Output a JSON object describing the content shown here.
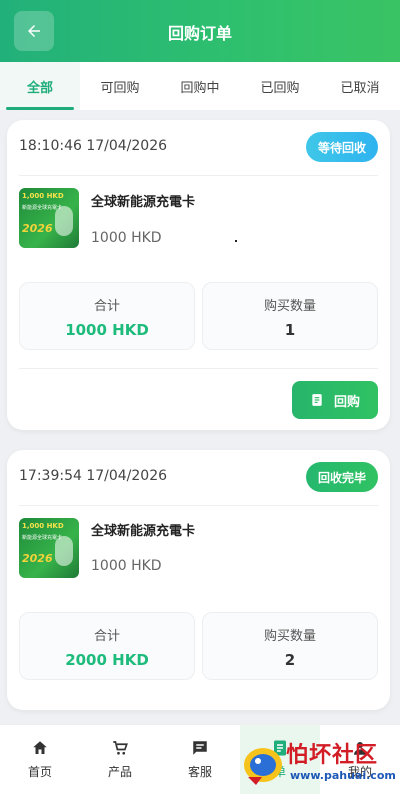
{
  "header": {
    "title": "回购订单"
  },
  "tabs": [
    {
      "label": "全部",
      "active": true
    },
    {
      "label": "可回购"
    },
    {
      "label": "回购中"
    },
    {
      "label": "已回购"
    },
    {
      "label": "已取消"
    }
  ],
  "orders": [
    {
      "time": "18:10:46 17/04/2026",
      "status": "等待回收",
      "product": {
        "name": "全球新能源充電卡",
        "price": "1000 HKD",
        "thumb": {
          "line1": "1,000 HKD",
          "line2": "新能源全球充電卡",
          "year": "2026"
        }
      },
      "total_label": "合计",
      "total_value": "1000 HKD",
      "qty_label": "购买数量",
      "qty_value": "1",
      "action_label": "回购"
    },
    {
      "time": "17:39:54 17/04/2026",
      "status": "回收完毕",
      "product": {
        "name": "全球新能源充電卡",
        "price": "1000 HKD",
        "thumb": {
          "line1": "1,000 HKD",
          "line2": "新能源全球充電卡",
          "year": "2026"
        }
      },
      "total_label": "合计",
      "total_value": "2000 HKD",
      "qty_label": "购买数量",
      "qty_value": "2"
    }
  ],
  "nav": [
    {
      "label": "首页",
      "icon": "home-icon"
    },
    {
      "label": "产品",
      "icon": "cart-icon"
    },
    {
      "label": "客服",
      "icon": "chat-icon"
    },
    {
      "label": "单",
      "icon": "orders-icon",
      "active": true
    },
    {
      "label": "我的",
      "icon": "user-icon"
    }
  ],
  "watermark": {
    "text": "怕坏社区",
    "url": "www.pahuai.com"
  },
  "colors": {
    "primary": "#1fae7b",
    "accent_blue": "#2fb3f0"
  }
}
